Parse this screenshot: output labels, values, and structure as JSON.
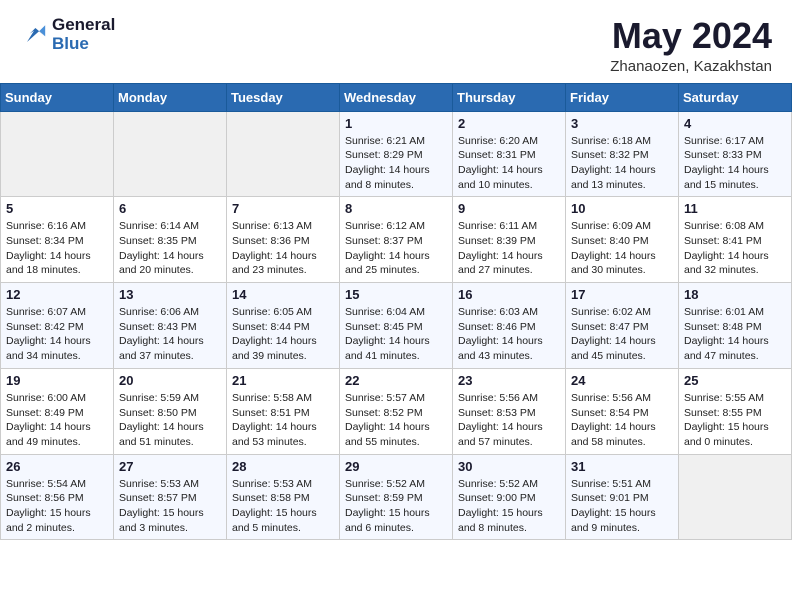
{
  "header": {
    "logo_line1": "General",
    "logo_line2": "Blue",
    "month": "May 2024",
    "location": "Zhanaozen, Kazakhstan"
  },
  "weekdays": [
    "Sunday",
    "Monday",
    "Tuesday",
    "Wednesday",
    "Thursday",
    "Friday",
    "Saturday"
  ],
  "weeks": [
    [
      {
        "day": "",
        "text": ""
      },
      {
        "day": "",
        "text": ""
      },
      {
        "day": "",
        "text": ""
      },
      {
        "day": "1",
        "text": "Sunrise: 6:21 AM\nSunset: 8:29 PM\nDaylight: 14 hours\nand 8 minutes."
      },
      {
        "day": "2",
        "text": "Sunrise: 6:20 AM\nSunset: 8:31 PM\nDaylight: 14 hours\nand 10 minutes."
      },
      {
        "day": "3",
        "text": "Sunrise: 6:18 AM\nSunset: 8:32 PM\nDaylight: 14 hours\nand 13 minutes."
      },
      {
        "day": "4",
        "text": "Sunrise: 6:17 AM\nSunset: 8:33 PM\nDaylight: 14 hours\nand 15 minutes."
      }
    ],
    [
      {
        "day": "5",
        "text": "Sunrise: 6:16 AM\nSunset: 8:34 PM\nDaylight: 14 hours\nand 18 minutes."
      },
      {
        "day": "6",
        "text": "Sunrise: 6:14 AM\nSunset: 8:35 PM\nDaylight: 14 hours\nand 20 minutes."
      },
      {
        "day": "7",
        "text": "Sunrise: 6:13 AM\nSunset: 8:36 PM\nDaylight: 14 hours\nand 23 minutes."
      },
      {
        "day": "8",
        "text": "Sunrise: 6:12 AM\nSunset: 8:37 PM\nDaylight: 14 hours\nand 25 minutes."
      },
      {
        "day": "9",
        "text": "Sunrise: 6:11 AM\nSunset: 8:39 PM\nDaylight: 14 hours\nand 27 minutes."
      },
      {
        "day": "10",
        "text": "Sunrise: 6:09 AM\nSunset: 8:40 PM\nDaylight: 14 hours\nand 30 minutes."
      },
      {
        "day": "11",
        "text": "Sunrise: 6:08 AM\nSunset: 8:41 PM\nDaylight: 14 hours\nand 32 minutes."
      }
    ],
    [
      {
        "day": "12",
        "text": "Sunrise: 6:07 AM\nSunset: 8:42 PM\nDaylight: 14 hours\nand 34 minutes."
      },
      {
        "day": "13",
        "text": "Sunrise: 6:06 AM\nSunset: 8:43 PM\nDaylight: 14 hours\nand 37 minutes."
      },
      {
        "day": "14",
        "text": "Sunrise: 6:05 AM\nSunset: 8:44 PM\nDaylight: 14 hours\nand 39 minutes."
      },
      {
        "day": "15",
        "text": "Sunrise: 6:04 AM\nSunset: 8:45 PM\nDaylight: 14 hours\nand 41 minutes."
      },
      {
        "day": "16",
        "text": "Sunrise: 6:03 AM\nSunset: 8:46 PM\nDaylight: 14 hours\nand 43 minutes."
      },
      {
        "day": "17",
        "text": "Sunrise: 6:02 AM\nSunset: 8:47 PM\nDaylight: 14 hours\nand 45 minutes."
      },
      {
        "day": "18",
        "text": "Sunrise: 6:01 AM\nSunset: 8:48 PM\nDaylight: 14 hours\nand 47 minutes."
      }
    ],
    [
      {
        "day": "19",
        "text": "Sunrise: 6:00 AM\nSunset: 8:49 PM\nDaylight: 14 hours\nand 49 minutes."
      },
      {
        "day": "20",
        "text": "Sunrise: 5:59 AM\nSunset: 8:50 PM\nDaylight: 14 hours\nand 51 minutes."
      },
      {
        "day": "21",
        "text": "Sunrise: 5:58 AM\nSunset: 8:51 PM\nDaylight: 14 hours\nand 53 minutes."
      },
      {
        "day": "22",
        "text": "Sunrise: 5:57 AM\nSunset: 8:52 PM\nDaylight: 14 hours\nand 55 minutes."
      },
      {
        "day": "23",
        "text": "Sunrise: 5:56 AM\nSunset: 8:53 PM\nDaylight: 14 hours\nand 57 minutes."
      },
      {
        "day": "24",
        "text": "Sunrise: 5:56 AM\nSunset: 8:54 PM\nDaylight: 14 hours\nand 58 minutes."
      },
      {
        "day": "25",
        "text": "Sunrise: 5:55 AM\nSunset: 8:55 PM\nDaylight: 15 hours\nand 0 minutes."
      }
    ],
    [
      {
        "day": "26",
        "text": "Sunrise: 5:54 AM\nSunset: 8:56 PM\nDaylight: 15 hours\nand 2 minutes."
      },
      {
        "day": "27",
        "text": "Sunrise: 5:53 AM\nSunset: 8:57 PM\nDaylight: 15 hours\nand 3 minutes."
      },
      {
        "day": "28",
        "text": "Sunrise: 5:53 AM\nSunset: 8:58 PM\nDaylight: 15 hours\nand 5 minutes."
      },
      {
        "day": "29",
        "text": "Sunrise: 5:52 AM\nSunset: 8:59 PM\nDaylight: 15 hours\nand 6 minutes."
      },
      {
        "day": "30",
        "text": "Sunrise: 5:52 AM\nSunset: 9:00 PM\nDaylight: 15 hours\nand 8 minutes."
      },
      {
        "day": "31",
        "text": "Sunrise: 5:51 AM\nSunset: 9:01 PM\nDaylight: 15 hours\nand 9 minutes."
      },
      {
        "day": "",
        "text": ""
      }
    ]
  ]
}
